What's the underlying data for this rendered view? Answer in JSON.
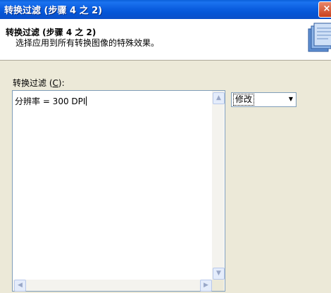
{
  "window": {
    "title": "转换过滤 (步骤 4 之 2)",
    "close_glyph": "×"
  },
  "header": {
    "title": "转换过滤 (步骤 4 之 2)",
    "description": "选择应用到所有转换图像的特殊效果。",
    "icon": "wizard-book-icon"
  },
  "filter": {
    "label_prefix": "转换过滤 (",
    "label_key": "C",
    "label_suffix": "):",
    "textarea_value": "分辨率 = 300 DPI",
    "scroll_up": "▲",
    "scroll_down": "▼",
    "scroll_left": "◀",
    "scroll_right": "▶"
  },
  "action_select": {
    "selected": "修改",
    "arrow": "▼"
  },
  "colors": {
    "titlebar": "#0455d6",
    "dialog_bg": "#ece9d8",
    "header_bg": "#ffffff",
    "border": "#7f9db9"
  }
}
